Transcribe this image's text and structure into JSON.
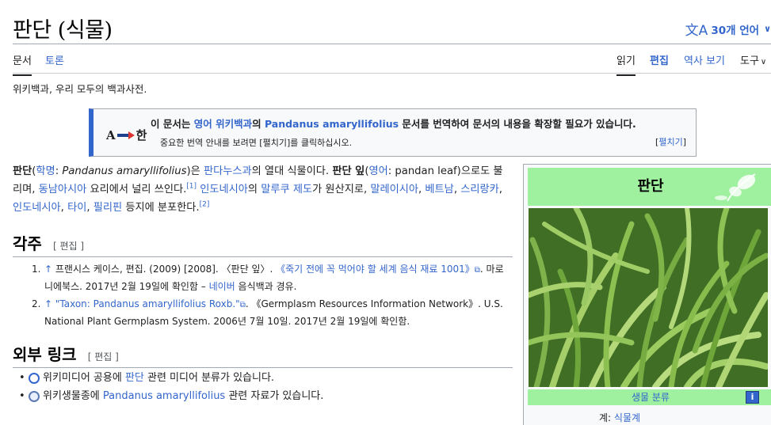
{
  "page": {
    "title": "판단 (식물)",
    "languages": "30개 언어",
    "tagline": "위키백과, 우리 모두의 백과사전."
  },
  "tabs": {
    "article": "문서",
    "talk": "토론",
    "read": "읽기",
    "edit": "편집",
    "history": "역사 보기",
    "tools": "도구"
  },
  "notice": {
    "icon_from": "A",
    "icon_to": "한",
    "main_prefix": "이 문서는 ",
    "main_link1": "영어 위키백과",
    "main_mid": "의 ",
    "main_link2": "Pandanus amaryllifolius",
    "main_suffix": " 문서를 번역하여 문서의 내용을 확장할 필요가 있습니다.",
    "sub": "중요한 번역 안내를 보려면 [펼치기]를 클릭하십시오.",
    "toggle": "[펼치기]"
  },
  "intro": {
    "b1": "판단",
    "t1": "(",
    "l1": "학명",
    "t2": ": ",
    "i1": "Pandanus amaryllifolius",
    "t3": ")은 ",
    "l2": "판다누스과",
    "t4": "의 열대 식물이다. ",
    "b2": "판단 잎",
    "t5": "(",
    "l3": "영어",
    "t6": ": pandan leaf)으로도 불리며, ",
    "l4": "동남아시아",
    "t7": " 요리에서 널리 쓰인다.",
    "s1": "[1]",
    "t8": " ",
    "l5": "인도네시아",
    "t9": "의 ",
    "l6": "말루쿠 제도",
    "t10": "가 원산지로, ",
    "l7": "말레이시아",
    "t11": ", ",
    "l8": "베트남",
    "t12": ", ",
    "l9": "스리랑카",
    "t13": ", ",
    "l10": "인도네시아",
    "t14": ", ",
    "l11": "타이",
    "t15": ", ",
    "l12": "필리핀",
    "t16": " 등지에 분포한다.",
    "s2": "[2]"
  },
  "refs_section": {
    "heading": "각주",
    "edit": "[ 편집 ]",
    "items": [
      {
        "num": "1.",
        "up": "↑",
        "a": " 프랜시스 케이스, 편집. (2009) [2008]. 〈판단 잎〉. ",
        "link": "《죽기 전에 꼭 먹어야 할 세계 음식 재료 1001》",
        "ext": "⧉",
        "b": ". 마로니에북스. 2017년 2월 19일에 확인함 – ",
        "link2": "네이버",
        "c": " 음식백과 경유."
      },
      {
        "num": "2.",
        "up": "↑",
        "link": " \"Taxon: Pandanus amaryllifolius Roxb.\"",
        "ext": "⧉",
        "b": ". 《Germplasm Resources Information Network》. U.S. National Plant Germplasm System. 2006년 7월 10일. 2017년 2월 19일에 확인함."
      }
    ]
  },
  "ext_section": {
    "heading": "외부 링크",
    "edit": "[ 편집 ]",
    "items": [
      {
        "a": "위키미디어 공용에 ",
        "link": "판단",
        "b": " 관련 미디어 분류가 있습니다."
      },
      {
        "a": "위키생물종에 ",
        "link": "Pandanus amaryllifolius",
        "b": " 관련 자료가 있습니다."
      }
    ]
  },
  "infobox": {
    "title": "판단",
    "classification": "생물 분류",
    "info": "i",
    "kingdom_label": "계:",
    "kingdom": "식물계"
  }
}
